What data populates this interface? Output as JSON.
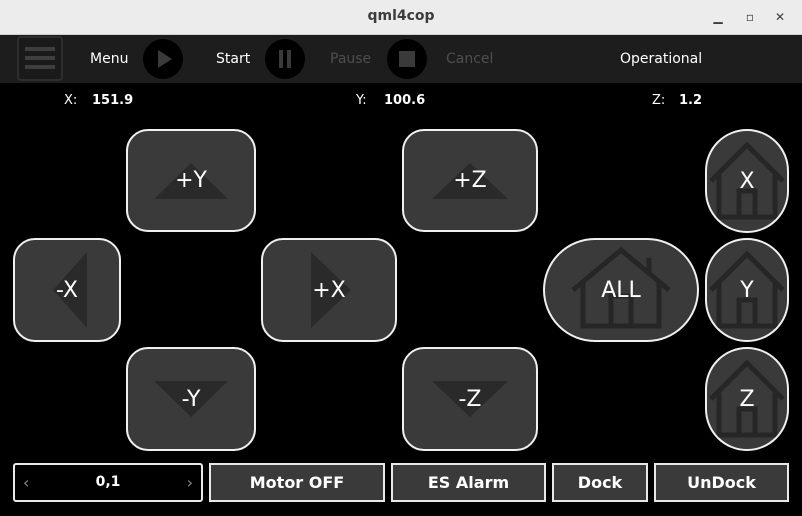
{
  "window": {
    "title": "qml4cop",
    "minimize_glyph": "▁",
    "maximize_glyph": "▫",
    "close_glyph": "✕"
  },
  "toolbar": {
    "menu_label": "Menu",
    "start_label": "Start",
    "pause_label": "Pause",
    "cancel_label": "Cancel",
    "status": "Operational"
  },
  "coords": {
    "x_label": "X:",
    "x_value": "151.9",
    "y_label": "Y:",
    "y_value": "100.6",
    "z_label": "Z:",
    "z_value": "1.2"
  },
  "jog": {
    "plus_y": "+Y",
    "minus_y": "-Y",
    "minus_x": "-X",
    "plus_x": "+X",
    "plus_z": "+Z",
    "minus_z": "-Z"
  },
  "home": {
    "all": "ALL",
    "x": "X",
    "y": "Y",
    "z": "Z"
  },
  "bottom": {
    "step_value": "0,1",
    "step_prev": "‹",
    "step_next": "›",
    "motor_off": "Motor OFF",
    "es_alarm": "ES Alarm",
    "dock": "Dock",
    "undock": "UnDock"
  },
  "colors": {
    "button_bg": "#3a3a3a",
    "button_border": "#f0f0f0",
    "triangle": "#2a2a2a",
    "house": "#262626"
  }
}
